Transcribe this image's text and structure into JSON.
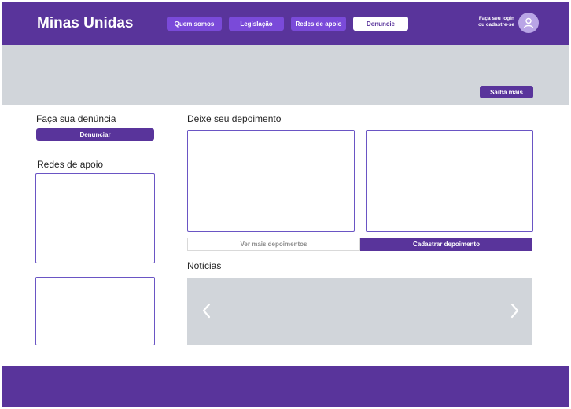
{
  "header": {
    "brand": "Minas Unidas",
    "nav": [
      "Quem somos",
      "Legislação",
      "Redes de apoio",
      "Denuncie"
    ],
    "login_line1": "Faça seu login",
    "login_line2": "ou cadastre-se",
    "avatar_icon": "user-icon"
  },
  "banner": {
    "cta": "Saiba mais"
  },
  "left": {
    "report_title": "Faça sua denúncia",
    "report_button": "Denunciar",
    "support_title": "Redes de apoio"
  },
  "testimonials": {
    "title": "Deixe seu depoimento",
    "see_more": "Ver mais depoimentos",
    "submit": "Cadastrar depoimento"
  },
  "news": {
    "title": "Notícias",
    "prev_icon": "chevron-left-icon",
    "next_icon": "chevron-right-icon"
  },
  "colors": {
    "primary": "#59349b",
    "nav_button": "#7a4ad9",
    "placeholder_gray": "#d1d5da",
    "box_border": "#6a55c4"
  }
}
